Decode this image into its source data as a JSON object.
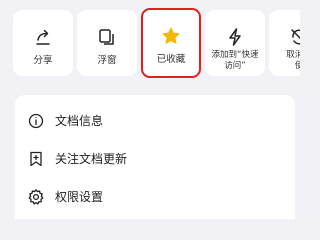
{
  "actions": [
    {
      "label": "分享",
      "icon": "share-icon"
    },
    {
      "label": "浮窗",
      "icon": "floating-window-icon"
    },
    {
      "label": "已收藏",
      "icon": "star-icon",
      "highlighted": true
    },
    {
      "label": "添加到“快速\n访问”",
      "icon": "lightning-icon"
    },
    {
      "label": "取消离\n使",
      "icon": "offline-icon"
    }
  ],
  "menu": [
    {
      "label": "文档信息",
      "icon": "info-icon"
    },
    {
      "label": "关注文档更新",
      "icon": "bookmark-icon"
    },
    {
      "label": "权限设置",
      "icon": "gear-icon"
    }
  ],
  "colors": {
    "highlight_border": "#e02020",
    "star": "#f5b800",
    "background": "#f2f2f6",
    "card": "#ffffff"
  }
}
